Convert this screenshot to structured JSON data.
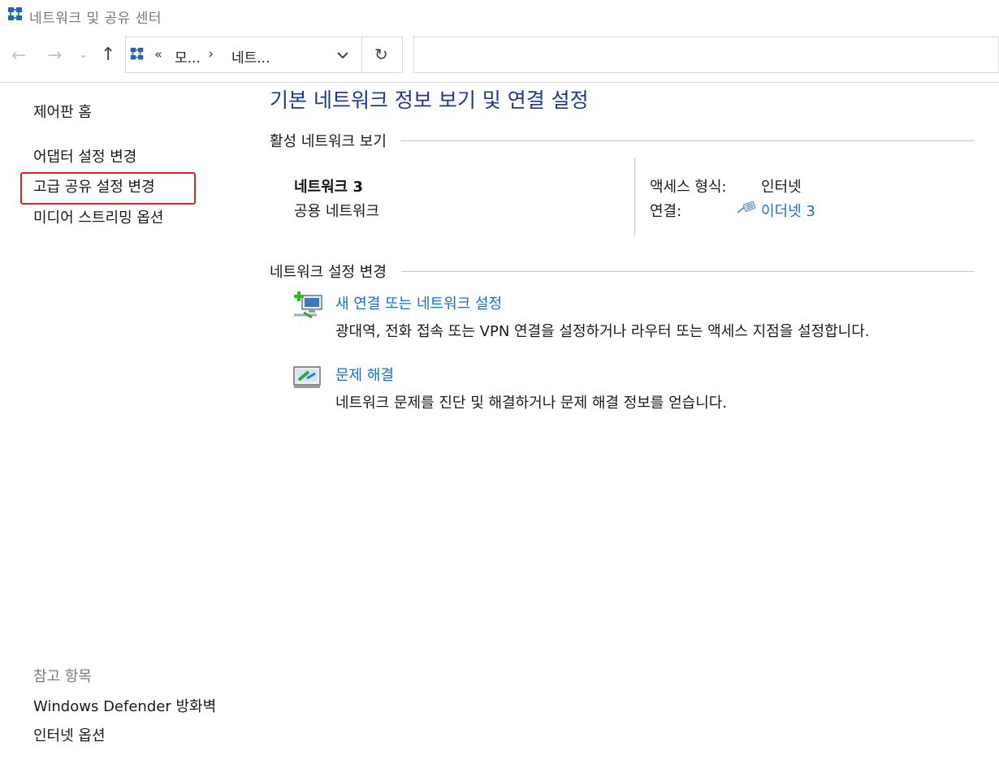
{
  "window": {
    "title": "네트워크 및 공유 센터",
    "icon": "network-center-icon"
  },
  "nav": {
    "back_label": "←",
    "forward_label": "→",
    "recent_label": "⌄",
    "up_label": "↑",
    "address_overflow": "«",
    "address_segments": [
      "모...",
      "네트..."
    ],
    "address_separator": "›",
    "refresh_label": "↻",
    "search_placeholder": ""
  },
  "sidebar": {
    "home": "제어판 홈",
    "items": [
      "어댑터 설정 변경",
      "고급 공유 설정 변경",
      "미디어 스트리밍 옵션"
    ],
    "highlighted_item": "고급 공유 설정 변경",
    "see_also_title": "참고 항목",
    "see_also": [
      "Windows Defender 방화벽",
      "인터넷 옵션"
    ]
  },
  "main": {
    "title": "기본 네트워크 정보 보기 및 연결 설정",
    "active_section_title": "활성 네트워크 보기",
    "network": {
      "name": "네트워크 3",
      "type": "공용 네트워크",
      "access_label": "액세스 형식:",
      "access_value": "인터넷",
      "connection_label": "연결:",
      "connection_value": "이더넷 3"
    },
    "change_section_title": "네트워크 설정 변경",
    "tasks": [
      {
        "icon": "new-connection-icon",
        "link": "새 연결 또는 네트워크 설정",
        "description": "광대역, 전화 접속 또는 VPN 연결을 설정하거나 라우터 또는 액세스 지점을 설정합니다."
      },
      {
        "icon": "troubleshoot-icon",
        "link": "문제 해결",
        "description": "네트워크 문제를 진단 및 해결하거나 문제 해결 정보를 얻습니다."
      }
    ]
  },
  "colors": {
    "title_blue": "#1e3a8a",
    "link_blue": "#1a6fc7",
    "highlight_red": "#e8201b",
    "muted_gray": "#7a7a7a"
  }
}
